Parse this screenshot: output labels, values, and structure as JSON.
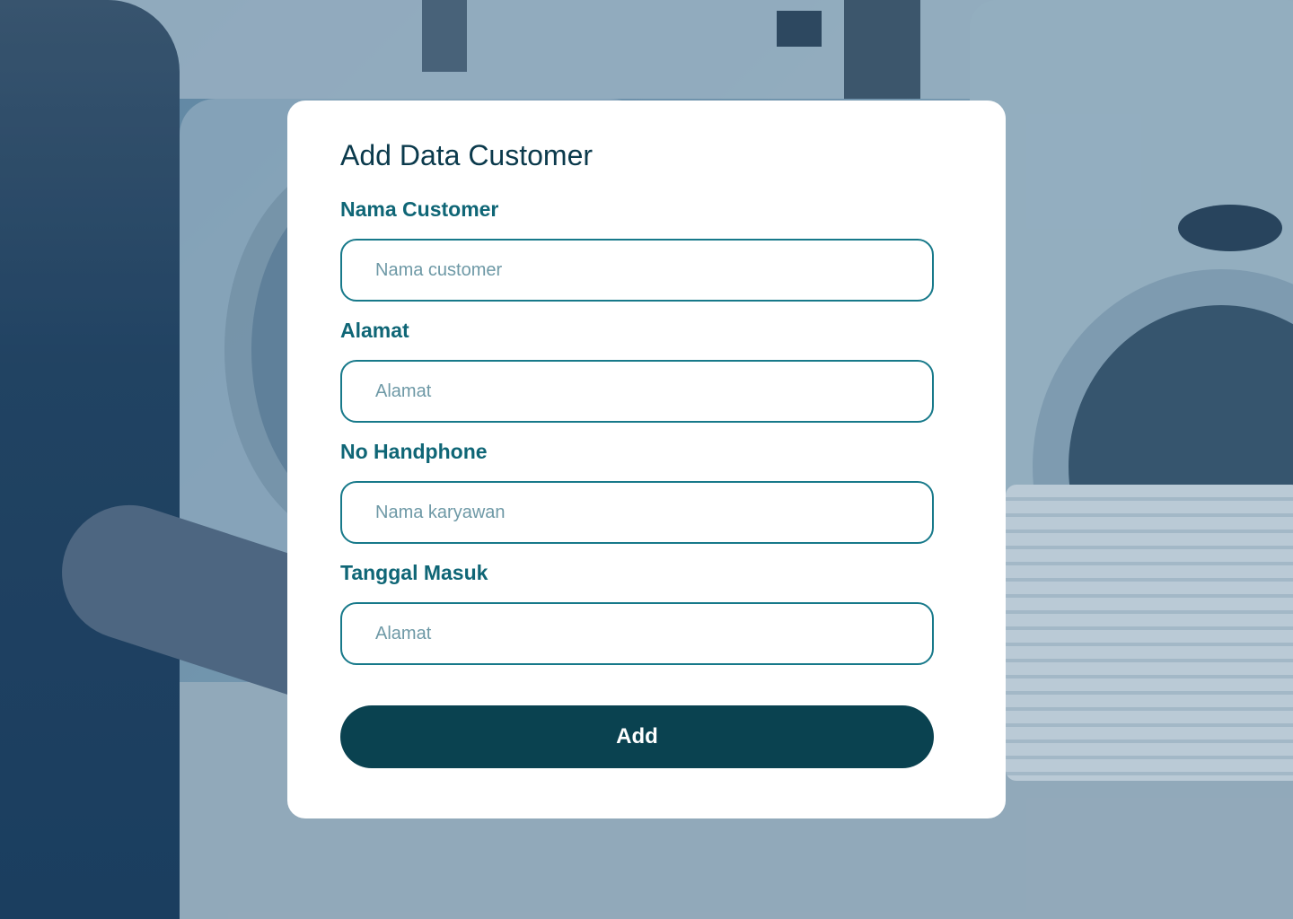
{
  "form": {
    "title": "Add Data Customer",
    "fields": [
      {
        "label": "Nama Customer",
        "placeholder": "Nama customer"
      },
      {
        "label": "Alamat",
        "placeholder": "Alamat"
      },
      {
        "label": "No Handphone",
        "placeholder": "Nama karyawan"
      },
      {
        "label": "Tanggal Masuk",
        "placeholder": "Alamat"
      }
    ],
    "submit_label": "Add"
  },
  "colors": {
    "label": "#0f6676",
    "input_border": "#17798a",
    "button_bg": "#0a4250",
    "title": "#0b3a4c"
  }
}
